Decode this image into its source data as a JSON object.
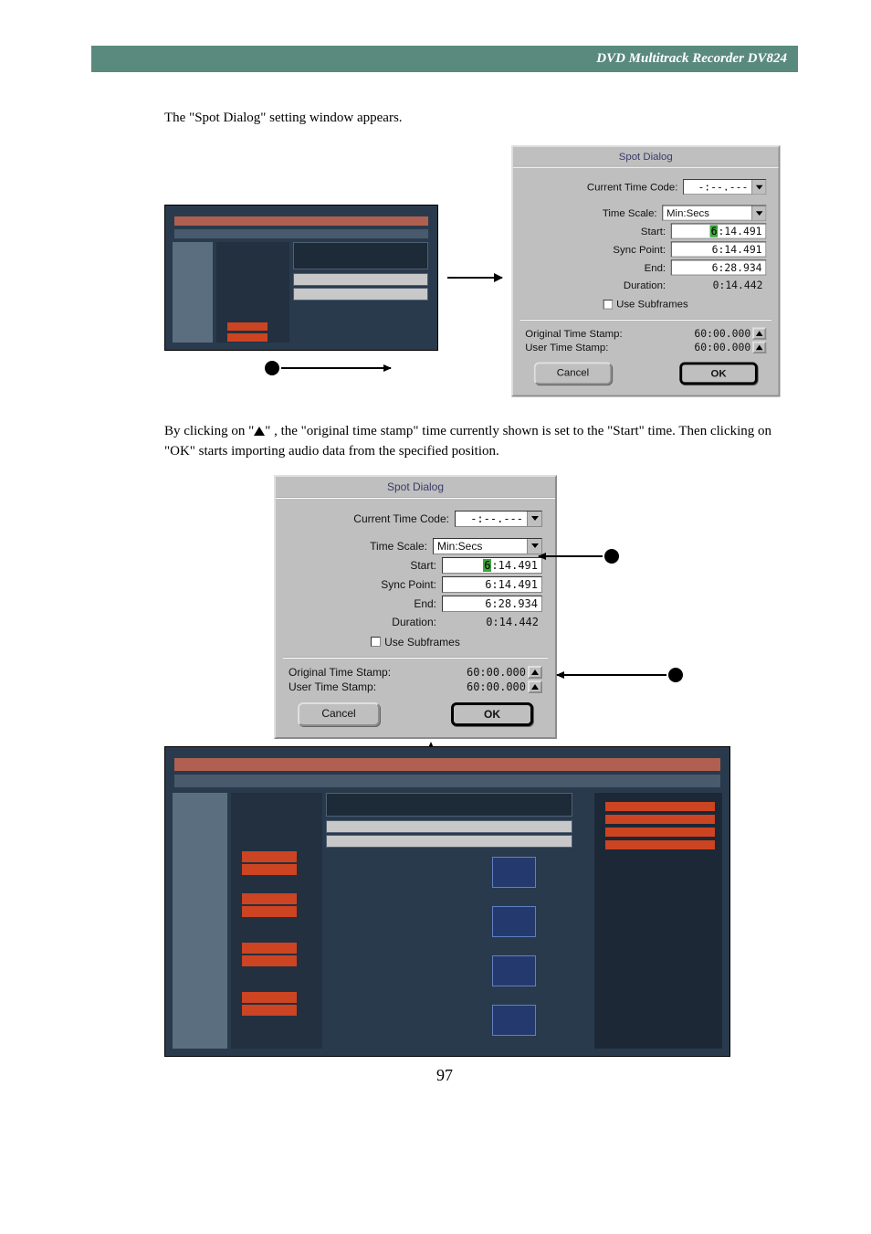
{
  "header": {
    "title": "DVD Multitrack Recorder DV824"
  },
  "intro_text": "The \"Spot Dialog\" setting window appears.",
  "spot_dialog": {
    "title": "Spot Dialog",
    "current_time_code_label": "Current Time Code:",
    "current_time_code_value": "-:--.---",
    "time_scale_label": "Time Scale:",
    "time_scale_value": "Min:Secs",
    "start_label": "Start:",
    "start_value_prefix": "6",
    "start_value_rest": ":14.491",
    "sync_point_label": "Sync Point:",
    "sync_point_value": "6:14.491",
    "end_label": "End:",
    "end_value": "6:28.934",
    "duration_label": "Duration:",
    "duration_value": "0:14.442",
    "use_subframes_label": "Use Subframes",
    "original_ts_label": "Original Time Stamp:",
    "original_ts_value": "60:00.000",
    "user_ts_label": "User Time Stamp:",
    "user_ts_value": "60:00.000",
    "cancel_label": "Cancel",
    "ok_label": "OK"
  },
  "explain_text_1": "By clicking on \"",
  "explain_text_2": "\" , the \"original time stamp\" time currently shown is set to the \"Start\" time. Then clicking on \"OK\" starts importing audio data from the specified position.",
  "page_number": "97",
  "chart_data": {
    "type": "table",
    "title": "Spot Dialog values",
    "labels": [
      "Time Scale",
      "Start",
      "Sync Point",
      "End",
      "Duration",
      "Original Time Stamp",
      "User Time Stamp"
    ],
    "values": [
      "Min:Secs",
      "6:14.491",
      "6:14.491",
      "6:28.934",
      "0:14.442",
      "60:00.000",
      "60:00.000"
    ]
  }
}
